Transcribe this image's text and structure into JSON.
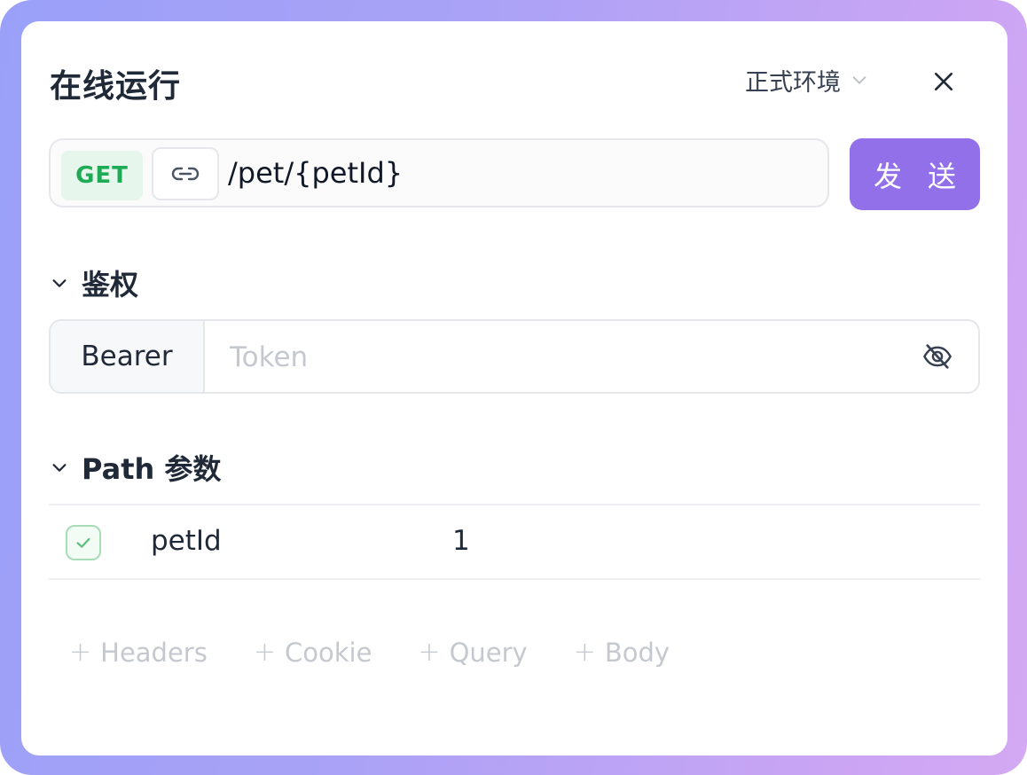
{
  "dialog": {
    "title": "在线运行",
    "environment": "正式环境"
  },
  "request": {
    "method": "GET",
    "path": "/pet/{petId}",
    "send_label": "发 送"
  },
  "auth": {
    "section_label": "鉴权",
    "type": "Bearer",
    "token_value": "",
    "token_placeholder": "Token"
  },
  "path_params": {
    "section_label": "Path 参数",
    "rows": [
      {
        "checked": true,
        "name": "petId",
        "value": "1"
      }
    ]
  },
  "add_buttons": [
    {
      "plus": "+",
      "label": "Headers"
    },
    {
      "plus": "+",
      "label": "Cookie"
    },
    {
      "plus": "+",
      "label": "Query"
    },
    {
      "plus": "+",
      "label": "Body"
    }
  ],
  "colors": {
    "accent": "#9270e9",
    "get_method": "#1eab55",
    "get_method_bg": "#e6f6ec",
    "checkbox_border": "#a8dcb6"
  }
}
